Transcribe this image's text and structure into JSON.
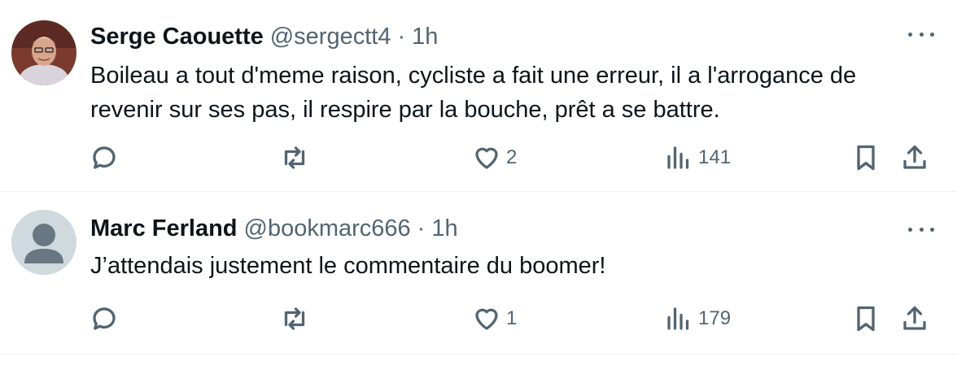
{
  "tweets": [
    {
      "name": "Serge Caouette",
      "handle": "@sergectt4",
      "separator": "·",
      "time": "1h",
      "text": "Boileau a tout d'meme raison, cycliste a fait une erreur, il a l'arrogance de revenir sur ses pas, il respire par la bouche, prêt a se battre.",
      "likes": "2",
      "views": "141"
    },
    {
      "name": "Marc Ferland",
      "handle": "@bookmarc666",
      "separator": "·",
      "time": "1h",
      "text": "J’attendais justement le commentaire du boomer!",
      "likes": "1",
      "views": "179"
    }
  ],
  "icons": {
    "reply": "reply-icon",
    "retweet": "retweet-icon",
    "like": "heart-icon",
    "views": "views-icon",
    "bookmark": "bookmark-icon",
    "share": "share-icon",
    "more": "more-icon"
  },
  "colors": {
    "text": "#0f1419",
    "secondary": "#536471",
    "divider": "#eff3f4"
  }
}
